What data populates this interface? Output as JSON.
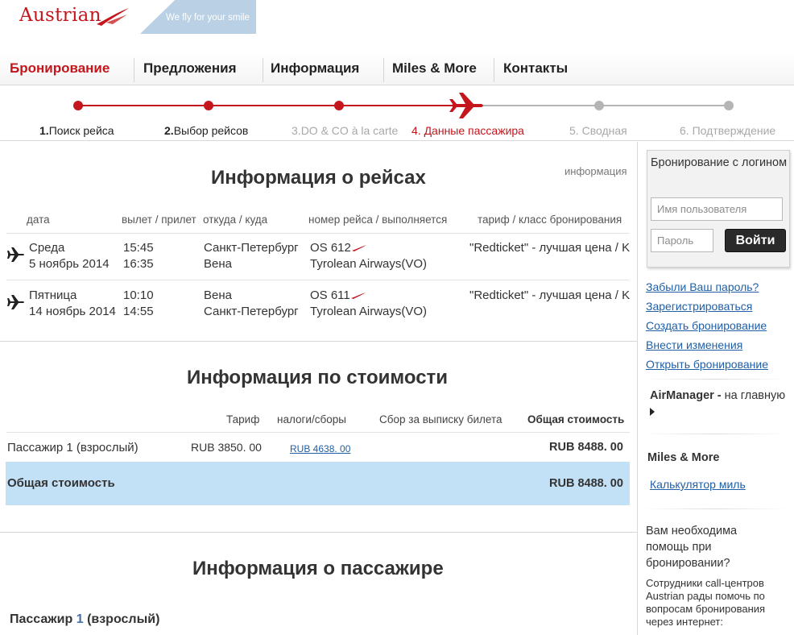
{
  "brand": {
    "logo_text": "Austrian",
    "slogan": "We fly for your smile",
    "accent": "#c4161c",
    "link_color": "#1f5fa8",
    "highlight_bg": "#c3e1f6"
  },
  "nav": {
    "items": [
      {
        "label": "Бронирование",
        "active": true
      },
      {
        "label": "Предложения"
      },
      {
        "label": "Информация"
      },
      {
        "label": "Miles & More"
      },
      {
        "label": "Контакты"
      }
    ]
  },
  "steps": [
    {
      "num": "1.",
      "label": "Поиск рейса",
      "state": "done"
    },
    {
      "num": "2.",
      "label": "Выбор рейсов",
      "state": "done"
    },
    {
      "num": "3.",
      "label": "DO & CO à la carte",
      "state": "done-faded"
    },
    {
      "num": "4.",
      "label": "Данные пассажира",
      "state": "current"
    },
    {
      "num": "5.",
      "label": "Сводная",
      "state": "future"
    },
    {
      "num": "6.",
      "label": "Подтверждение",
      "state": "future"
    }
  ],
  "flights": {
    "title": "Информация о рейсах",
    "info_link": "информация",
    "columns": {
      "date": "дата",
      "times": "вылет / прилет",
      "route": "откуда / куда",
      "flight": "номер рейса / выполняется",
      "fare": "тариф / класс бронирования"
    },
    "rows": [
      {
        "day": "Среда",
        "date": "5 ноябрь 2014",
        "dep": "15:45",
        "arr": "16:35",
        "from": "Санкт-Петербург",
        "to": "Вена",
        "flight_no": "OS 612",
        "operator": "Tyrolean Airways(VO)",
        "fare": "\"Redticket\" - лучшая цена / K"
      },
      {
        "day": "Пятница",
        "date": "14 ноябрь 2014",
        "dep": "10:10",
        "arr": "14:55",
        "from": "Вена",
        "to": "Санкт-Петербург",
        "flight_no": "OS 611",
        "operator": "Tyrolean Airways(VO)",
        "fare": "\"Redticket\" - лучшая цена / K"
      }
    ]
  },
  "cost": {
    "title": "Информация по стоимости",
    "columns": {
      "fare": "Тариф",
      "taxes": "налоги/сборы",
      "ticket_fee": "Сбор за выписку билета",
      "total": "Общая стоимость"
    },
    "passenger_row": {
      "label": "Пассажир 1 (взрослый)",
      "fare": "RUB 3850. 00",
      "taxes": "RUB 4638. 00",
      "total": "RUB 8488. 00"
    },
    "total_row": {
      "label": "Общая стоимость",
      "total": "RUB 8488. 00"
    }
  },
  "passenger": {
    "title": "Информация о пассажире",
    "label_prefix": "Пассажир",
    "number": "1",
    "label_suffix": "(взрослый)"
  },
  "sidebar": {
    "login": {
      "title": "Бронирование с логином",
      "username_placeholder": "Имя пользователя",
      "password_placeholder": "Пароль",
      "button": "Войти"
    },
    "links": [
      "Забыли Ваш пароль?",
      "Зарегистрироваться",
      "Создать бронирование",
      "Внести изменения",
      "Открыть бронирование"
    ],
    "airmanager": {
      "bold": "AirManager -",
      "rest": " на главную"
    },
    "miles": {
      "title": "Miles & More",
      "link": "Калькулятор миль"
    },
    "help": {
      "title": "Вам необходима помощь при бронировании?",
      "text": "Сотрудники call-центров Austrian рады помочь по вопросам бронирования через интернет:"
    }
  }
}
